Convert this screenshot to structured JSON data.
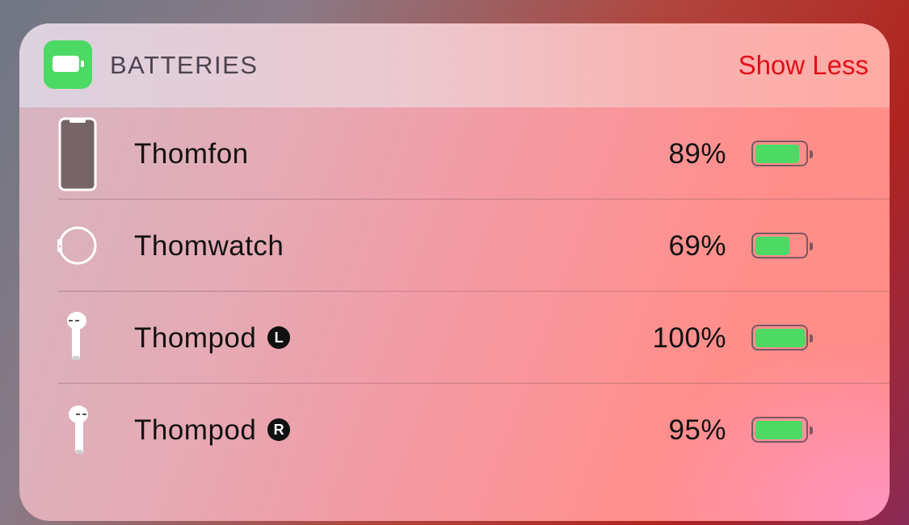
{
  "widget": {
    "title": "BATTERIES",
    "show_less_label": "Show Less",
    "icon": "battery-app-icon"
  },
  "devices": [
    {
      "name": "Thomfon",
      "side": "",
      "percent_label": "89%",
      "level": 0.89,
      "icon": "iphone-icon"
    },
    {
      "name": "Thomwatch",
      "side": "",
      "percent_label": "69%",
      "level": 0.69,
      "icon": "watch-icon"
    },
    {
      "name": "Thompod",
      "side": "L",
      "percent_label": "100%",
      "level": 1.0,
      "icon": "airpod-left-icon"
    },
    {
      "name": "Thompod",
      "side": "R",
      "percent_label": "95%",
      "level": 0.95,
      "icon": "airpod-right-icon"
    }
  ],
  "colors": {
    "accent": "#e0101a",
    "battery_fill": "#4cd964"
  }
}
